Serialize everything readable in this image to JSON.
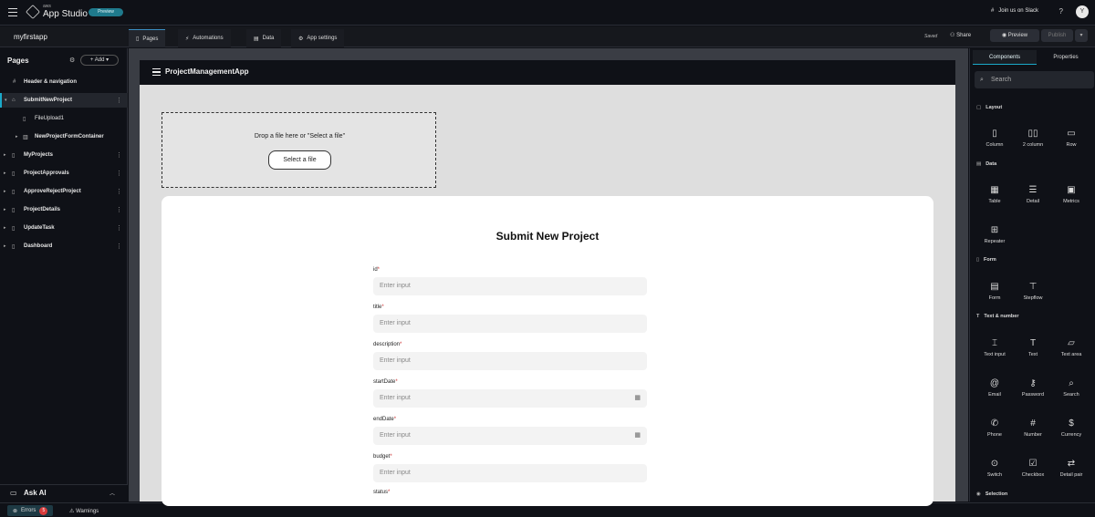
{
  "topbar": {
    "aws_label": "aws",
    "app_title": "App Studio",
    "preview_badge": "Preview",
    "slack_label": "Join us on Slack",
    "help_label": "?",
    "avatar_initial": "Y"
  },
  "subbar": {
    "app_name": "myfirstapp",
    "tabs": [
      {
        "label": "Pages"
      },
      {
        "label": "Automations"
      },
      {
        "label": "Data"
      },
      {
        "label": "App settings"
      }
    ],
    "saved_label": "Saved",
    "share_label": "Share",
    "preview_label": "Preview",
    "publish_label": "Publish"
  },
  "sidebar": {
    "title": "Pages",
    "add_label": "Add",
    "items": [
      {
        "label": "Header & navigation"
      },
      {
        "label": "SubmitNewProject"
      },
      {
        "label": "FileUpload1"
      },
      {
        "label": "NewProjectFormContainer"
      },
      {
        "label": "MyProjects"
      },
      {
        "label": "ProjectApprovals"
      },
      {
        "label": "ApproveRejectProject"
      },
      {
        "label": "ProjectDetails"
      },
      {
        "label": "UpdateTask"
      },
      {
        "label": "Dashboard"
      }
    ],
    "ask_ai_label": "Ask AI"
  },
  "bottom": {
    "errors_label": "Errors",
    "errors_count": "5",
    "warnings_label": "Warnings"
  },
  "app": {
    "header_title": "ProjectManagementApp",
    "drop_message": "Drop a file here or \"Select a file\"",
    "select_file_label": "Select a file",
    "form_title": "Submit New Project",
    "fields": [
      {
        "label": "id",
        "placeholder": "Enter input"
      },
      {
        "label": "title",
        "placeholder": "Enter input"
      },
      {
        "label": "description",
        "placeholder": "Enter input"
      },
      {
        "label": "startDate",
        "placeholder": "Enter input"
      },
      {
        "label": "endDate",
        "placeholder": "Enter input"
      },
      {
        "label": "budget",
        "placeholder": "Enter input"
      },
      {
        "label": "status",
        "placeholder": ""
      }
    ],
    "required_mark": "*"
  },
  "panel": {
    "tabs": [
      {
        "label": "Components"
      },
      {
        "label": "Properties"
      }
    ],
    "search_placeholder": "Search",
    "sections": [
      {
        "title": "Layout"
      },
      {
        "title": "Data"
      },
      {
        "title": "Form"
      },
      {
        "title": "Text & number"
      },
      {
        "title": "Selection"
      }
    ],
    "components": [
      {
        "label": "Column"
      },
      {
        "label": "2 column"
      },
      {
        "label": "Row"
      },
      {
        "label": "Table"
      },
      {
        "label": "Detail"
      },
      {
        "label": "Metrics"
      },
      {
        "label": "Repeater"
      },
      {
        "label": "Form"
      },
      {
        "label": "Stepflow"
      },
      {
        "label": "Text input"
      },
      {
        "label": "Text"
      },
      {
        "label": "Text area"
      },
      {
        "label": "Email"
      },
      {
        "label": "Password"
      },
      {
        "label": "Search"
      },
      {
        "label": "Phone"
      },
      {
        "label": "Number"
      },
      {
        "label": "Currency"
      },
      {
        "label": "Switch"
      },
      {
        "label": "Checkbox"
      },
      {
        "label": "Detail pair"
      }
    ]
  }
}
